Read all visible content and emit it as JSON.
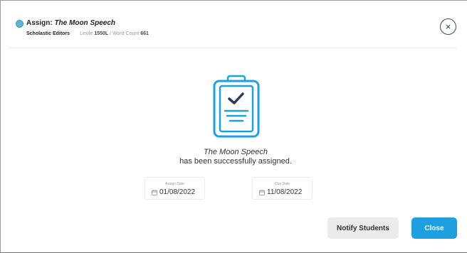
{
  "header": {
    "title_prefix": "Assign: ",
    "book_title": "The Moon Speech",
    "publisher": "Scholastic Editors",
    "lexile_label": "Lexile ",
    "lexile_value": "1550L",
    "separator": " / ",
    "word_count_label": "Word Count ",
    "word_count_value": "661",
    "close_symbol": "×"
  },
  "confirmation": {
    "book_title": "The Moon Speech",
    "message": "has been successfully assigned."
  },
  "dates": {
    "assign": {
      "label": "Assign Date",
      "value": "01/08/2022"
    },
    "due": {
      "label": "Due Date",
      "value": "11/08/2022"
    }
  },
  "buttons": {
    "notify_label": "Notify Students",
    "close_label": "Close"
  },
  "icons": {
    "header_dot": "status-dot-icon",
    "close": "close-icon",
    "illustration": "clipboard-check-icon",
    "calendar": "calendar-icon"
  },
  "colors": {
    "accent": "#1e9fe0",
    "illustration": "#1e9fe0",
    "checkmark": "#2d3a5c",
    "dot": "#5fb4d1"
  }
}
